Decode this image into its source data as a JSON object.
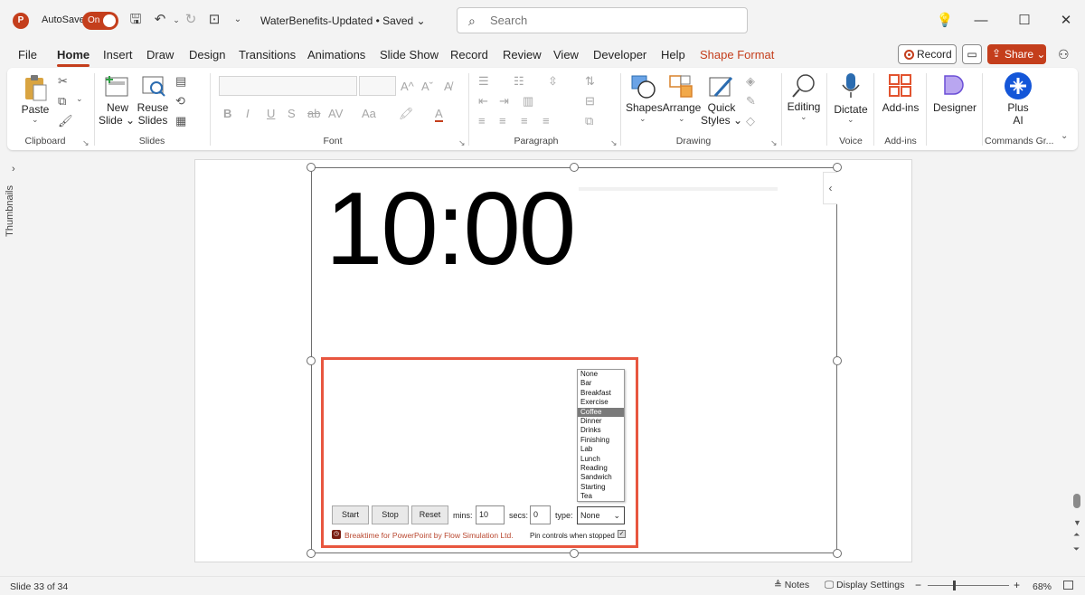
{
  "titlebar": {
    "logo": "P",
    "autosave_label": "AutoSave",
    "autosave_state": "On",
    "doc_title": "WaterBenefits-Updated • Saved ⌄",
    "search_placeholder": "Search"
  },
  "tabs": [
    "File",
    "Home",
    "Insert",
    "Draw",
    "Design",
    "Transitions",
    "Animations",
    "Slide Show",
    "Record",
    "Review",
    "View",
    "Developer",
    "Help",
    "Shape Format"
  ],
  "header_actions": {
    "record": "Record",
    "share": "Share ⌄"
  },
  "ribbon": {
    "clipboard": {
      "paste": "Paste",
      "group": "Clipboard"
    },
    "slides": {
      "new_slide_1": "New",
      "new_slide_2": "Slide ⌄",
      "reuse_1": "Reuse",
      "reuse_2": "Slides",
      "group": "Slides"
    },
    "font": {
      "group": "Font",
      "bold": "B",
      "italic": "I",
      "underline": "U",
      "strike": "S",
      "strike2": "ab",
      "spacing": "AV",
      "case": "Aa",
      "color": "A",
      "grow": "A^",
      "shrink": "Aˇ"
    },
    "paragraph": {
      "group": "Paragraph"
    },
    "drawing": {
      "shapes": "Shapes",
      "arrange": "Arrange",
      "quick_1": "Quick",
      "quick_2": "Styles ⌄",
      "group": "Drawing"
    },
    "editing": {
      "label": "Editing"
    },
    "voice": {
      "dictate": "Dictate",
      "group": "Voice"
    },
    "addins": {
      "label": "Add-ins",
      "group": "Add-ins"
    },
    "designer": {
      "label": "Designer"
    },
    "plus_ai": {
      "label_1": "Plus",
      "label_2": "AI",
      "group": "Commands Gr..."
    }
  },
  "thumbnails_label": "Thumbnails",
  "slide": {
    "timer": "10:00",
    "addin": {
      "buttons": {
        "start": "Start",
        "stop": "Stop",
        "reset": "Reset"
      },
      "mins_label": "mins:",
      "mins_value": "10",
      "secs_label": "secs:",
      "secs_value": "0",
      "type_label": "type:",
      "type_value": "None",
      "type_options": [
        "None",
        "Bar",
        "Breakfast",
        "Exercise",
        "Coffee",
        "Dinner",
        "Drinks",
        "Finishing",
        "Lab",
        "Lunch",
        "Reading",
        "Sandwich",
        "Starting",
        "Tea"
      ],
      "highlighted_option": "Coffee",
      "brand": "Breaktime for PowerPoint by Flow Simulation Ltd.",
      "pin_label": "Pin controls when stopped"
    }
  },
  "statusbar": {
    "slide_count": "Slide 33 of 34",
    "notes": "Notes",
    "display_settings": "Display Settings",
    "zoom": "68%"
  },
  "colors": {
    "accent": "#c43e1c",
    "addin_border": "#e8563f"
  }
}
